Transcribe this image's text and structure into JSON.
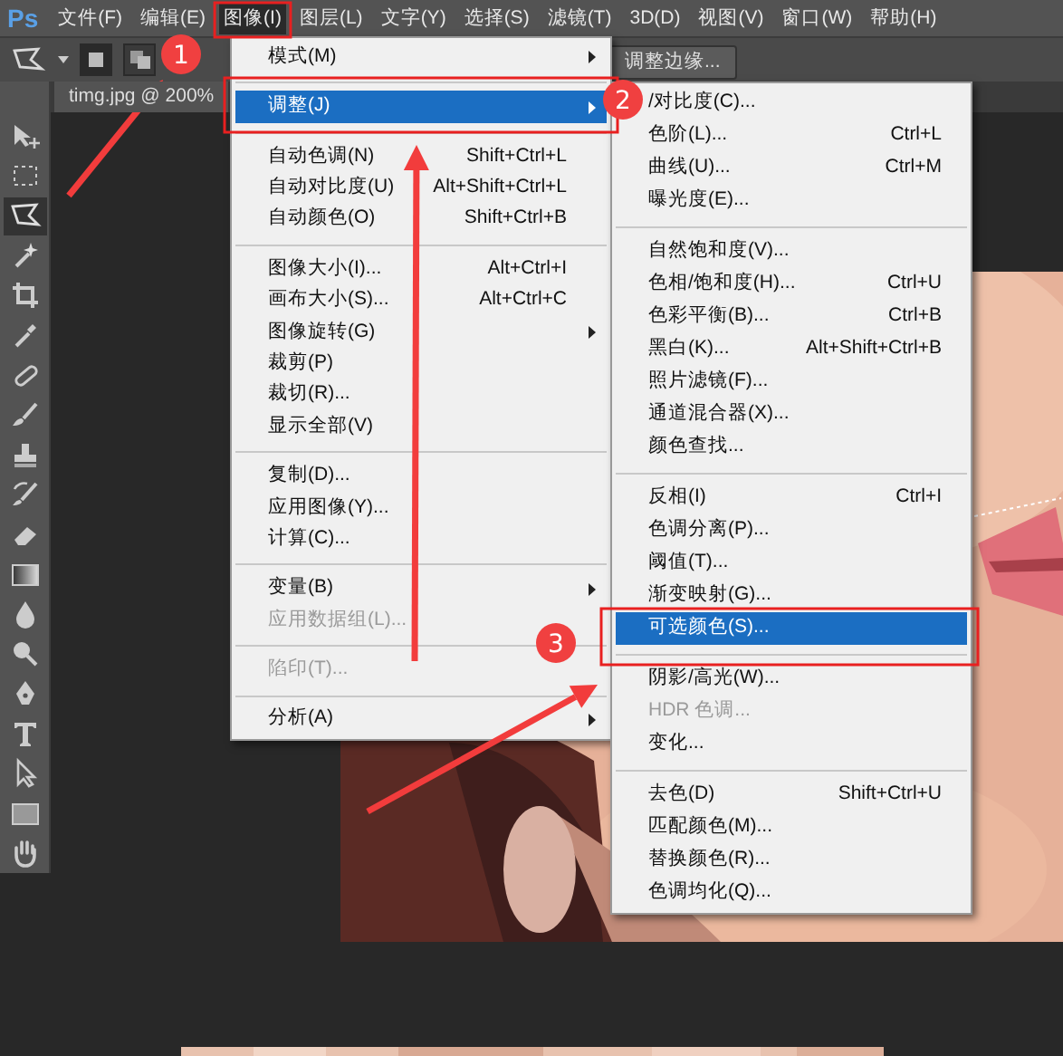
{
  "menubar": [
    {
      "label": "文件(F)",
      "selected": false
    },
    {
      "label": "编辑(E)",
      "selected": false
    },
    {
      "label": "图像(I)",
      "selected": true
    },
    {
      "label": "图层(L)",
      "selected": false
    },
    {
      "label": "文字(Y)",
      "selected": false
    },
    {
      "label": "选择(S)",
      "selected": false
    },
    {
      "label": "滤镜(T)",
      "selected": false
    },
    {
      "label": "3D(D)",
      "selected": false
    },
    {
      "label": "视图(V)",
      "selected": false
    },
    {
      "label": "窗口(W)",
      "selected": false
    },
    {
      "label": "帮助(H)",
      "selected": false
    }
  ],
  "logo": "Ps",
  "options_bar": {
    "refine_edge_button": "调整边缘..."
  },
  "document_tab": {
    "title": "timg.jpg @ 200%"
  },
  "tools": [
    {
      "kind": "move",
      "selected": false
    },
    {
      "kind": "marquee",
      "selected": false
    },
    {
      "kind": "lasso",
      "selected": true
    },
    {
      "kind": "wand",
      "selected": false
    },
    {
      "kind": "crop",
      "selected": false
    },
    {
      "kind": "eyedropper",
      "selected": false
    },
    {
      "kind": "healing",
      "selected": false
    },
    {
      "kind": "brush",
      "selected": false
    },
    {
      "kind": "stamp",
      "selected": false
    },
    {
      "kind": "history",
      "selected": false
    },
    {
      "kind": "eraser",
      "selected": false
    },
    {
      "kind": "gradient",
      "selected": false
    },
    {
      "kind": "blur",
      "selected": false
    },
    {
      "kind": "dodge",
      "selected": false
    },
    {
      "kind": "pen",
      "selected": false
    },
    {
      "kind": "type",
      "selected": false
    },
    {
      "kind": "path",
      "selected": false
    },
    {
      "kind": "shape",
      "selected": false
    },
    {
      "kind": "hand",
      "selected": false
    }
  ],
  "image_menu": {
    "items": [
      {
        "kind": "item",
        "label": "模式(M)",
        "submenu": true,
        "selected": false,
        "disabled": false
      },
      {
        "kind": "separator"
      },
      {
        "kind": "item",
        "label": "调整(J)",
        "submenu": true,
        "selected": true,
        "disabled": false
      },
      {
        "kind": "separator"
      },
      {
        "kind": "item",
        "label": "自动色调(N)",
        "shortcut": "Shift+Ctrl+L",
        "submenu": false,
        "selected": false,
        "disabled": false
      },
      {
        "kind": "item",
        "label": "自动对比度(U)",
        "shortcut": "Alt+Shift+Ctrl+L",
        "submenu": false,
        "selected": false,
        "disabled": false
      },
      {
        "kind": "item",
        "label": "自动颜色(O)",
        "shortcut": "Shift+Ctrl+B",
        "submenu": false,
        "selected": false,
        "disabled": false
      },
      {
        "kind": "separator"
      },
      {
        "kind": "item",
        "label": "图像大小(I)...",
        "shortcut": "Alt+Ctrl+I",
        "submenu": false,
        "selected": false,
        "disabled": false
      },
      {
        "kind": "item",
        "label": "画布大小(S)...",
        "shortcut": "Alt+Ctrl+C",
        "submenu": false,
        "selected": false,
        "disabled": false
      },
      {
        "kind": "item",
        "label": "图像旋转(G)",
        "submenu": true,
        "selected": false,
        "disabled": false
      },
      {
        "kind": "item",
        "label": "裁剪(P)",
        "submenu": false,
        "selected": false,
        "disabled": false
      },
      {
        "kind": "item",
        "label": "裁切(R)...",
        "submenu": false,
        "selected": false,
        "disabled": false
      },
      {
        "kind": "item",
        "label": "显示全部(V)",
        "submenu": false,
        "selected": false,
        "disabled": false
      },
      {
        "kind": "separator"
      },
      {
        "kind": "item",
        "label": "复制(D)...",
        "submenu": false,
        "selected": false,
        "disabled": false
      },
      {
        "kind": "item",
        "label": "应用图像(Y)...",
        "submenu": false,
        "selected": false,
        "disabled": false
      },
      {
        "kind": "item",
        "label": "计算(C)...",
        "submenu": false,
        "selected": false,
        "disabled": false
      },
      {
        "kind": "separator"
      },
      {
        "kind": "item",
        "label": "变量(B)",
        "submenu": true,
        "selected": false,
        "disabled": false
      },
      {
        "kind": "item",
        "label": "应用数据组(L)...",
        "submenu": false,
        "selected": false,
        "disabled": true
      },
      {
        "kind": "separator"
      },
      {
        "kind": "item",
        "label": "陷印(T)...",
        "submenu": false,
        "selected": false,
        "disabled": true
      },
      {
        "kind": "separator"
      },
      {
        "kind": "item",
        "label": "分析(A)",
        "submenu": true,
        "selected": false,
        "disabled": false
      }
    ]
  },
  "adjust_submenu": {
    "items": [
      {
        "kind": "item",
        "label": "/对比度(C)...",
        "selected": false,
        "disabled": false
      },
      {
        "kind": "item",
        "label": "色阶(L)...",
        "shortcut": "Ctrl+L",
        "selected": false,
        "disabled": false
      },
      {
        "kind": "item",
        "label": "曲线(U)...",
        "shortcut": "Ctrl+M",
        "selected": false,
        "disabled": false
      },
      {
        "kind": "item",
        "label": "曝光度(E)...",
        "selected": false,
        "disabled": false
      },
      {
        "kind": "separator"
      },
      {
        "kind": "item",
        "label": "自然饱和度(V)...",
        "selected": false,
        "disabled": false
      },
      {
        "kind": "item",
        "label": "色相/饱和度(H)...",
        "shortcut": "Ctrl+U",
        "selected": false,
        "disabled": false
      },
      {
        "kind": "item",
        "label": "色彩平衡(B)...",
        "shortcut": "Ctrl+B",
        "selected": false,
        "disabled": false
      },
      {
        "kind": "item",
        "label": "黑白(K)...",
        "shortcut": "Alt+Shift+Ctrl+B",
        "selected": false,
        "disabled": false
      },
      {
        "kind": "item",
        "label": "照片滤镜(F)...",
        "selected": false,
        "disabled": false
      },
      {
        "kind": "item",
        "label": "通道混合器(X)...",
        "selected": false,
        "disabled": false
      },
      {
        "kind": "item",
        "label": "颜色查找...",
        "selected": false,
        "disabled": false
      },
      {
        "kind": "separator"
      },
      {
        "kind": "item",
        "label": "反相(I)",
        "shortcut": "Ctrl+I",
        "selected": false,
        "disabled": false
      },
      {
        "kind": "item",
        "label": "色调分离(P)...",
        "selected": false,
        "disabled": false
      },
      {
        "kind": "item",
        "label": "阈值(T)...",
        "selected": false,
        "disabled": false
      },
      {
        "kind": "item",
        "label": "渐变映射(G)...",
        "selected": false,
        "disabled": false
      },
      {
        "kind": "item",
        "label": "可选颜色(S)...",
        "selected": true,
        "disabled": false
      },
      {
        "kind": "separator"
      },
      {
        "kind": "item",
        "label": "阴影/高光(W)...",
        "selected": false,
        "disabled": false
      },
      {
        "kind": "item",
        "label": "HDR 色调...",
        "selected": false,
        "disabled": true
      },
      {
        "kind": "item",
        "label": "变化...",
        "selected": false,
        "disabled": false
      },
      {
        "kind": "separator"
      },
      {
        "kind": "item",
        "label": "去色(D)",
        "shortcut": "Shift+Ctrl+U",
        "selected": false,
        "disabled": false
      },
      {
        "kind": "item",
        "label": "匹配颜色(M)...",
        "selected": false,
        "disabled": false
      },
      {
        "kind": "item",
        "label": "替换颜色(R)...",
        "selected": false,
        "disabled": false
      },
      {
        "kind": "item",
        "label": "色调均化(Q)...",
        "selected": false,
        "disabled": false
      }
    ]
  },
  "annotations": [
    {
      "label": "1"
    },
    {
      "label": "2"
    },
    {
      "label": "3"
    }
  ]
}
